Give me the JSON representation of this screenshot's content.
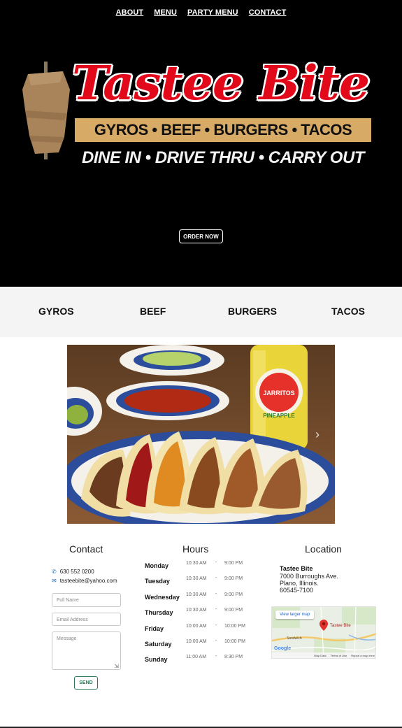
{
  "nav": {
    "items": [
      "ABOUT",
      "MENU",
      "PARTY MENU",
      "CONTACT"
    ]
  },
  "logo": {
    "name": "Tastee Bite",
    "food_line": "GYROS • BEEF • BURGERS • TACOS",
    "service_line": "DINE IN  •  DRIVE THRU  •  CARRY OUT"
  },
  "hero": {
    "order_button": "ORDER NOW"
  },
  "categories": [
    "GYROS",
    "BEEF",
    "BURGERS",
    "TACOS"
  ],
  "carousel": {
    "next_icon": "chevron-right-icon",
    "bottle_brand": "JARRITOS",
    "bottle_flavor": "PINEAPPLE"
  },
  "contact": {
    "title": "Contact",
    "phone": "630 552 0200",
    "email": "tasteebite@yahoo.com",
    "name_placeholder": "Full Name",
    "email_placeholder": "Email Address",
    "message_placeholder": "Message",
    "send_label": "SEND"
  },
  "hours": {
    "title": "Hours",
    "rows": [
      {
        "day": "Monday",
        "open": "10:30 AM",
        "close": "9:00 PM"
      },
      {
        "day": "Tuesday",
        "open": "10:30 AM",
        "close": "9:00 PM"
      },
      {
        "day": "Wednesday",
        "open": "10:30 AM",
        "close": "9:00 PM"
      },
      {
        "day": "Thursday",
        "open": "10:30 AM",
        "close": "9:00 PM"
      },
      {
        "day": "Friday",
        "open": "10:00 AM",
        "close": "10:00 PM"
      },
      {
        "day": "Saturday",
        "open": "10:00 AM",
        "close": "10:00 PM"
      },
      {
        "day": "Sunday",
        "open": "11:00 AM",
        "close": "8:30 PM"
      }
    ]
  },
  "location": {
    "title": "Location",
    "name": "Tastee Bite",
    "street": "7000 Burroughs Ave.",
    "city": "Plano, Illinois.",
    "zip": "60545-7100",
    "map_button": "View larger map",
    "map_pin_label": "Tastee Bite",
    "map_place": "Sandwich",
    "map_brand": "Google",
    "map_footer": [
      "Map Data",
      "Terms of Use",
      "Report a map error"
    ]
  },
  "colors": {
    "hero_bg": "#000000",
    "brand_red": "#e2091a",
    "band_tan": "#d7aa66",
    "category_bg": "#f4f4f4",
    "send_green": "#2c7a57",
    "phone_icon_blue": "#2a6fb5"
  }
}
